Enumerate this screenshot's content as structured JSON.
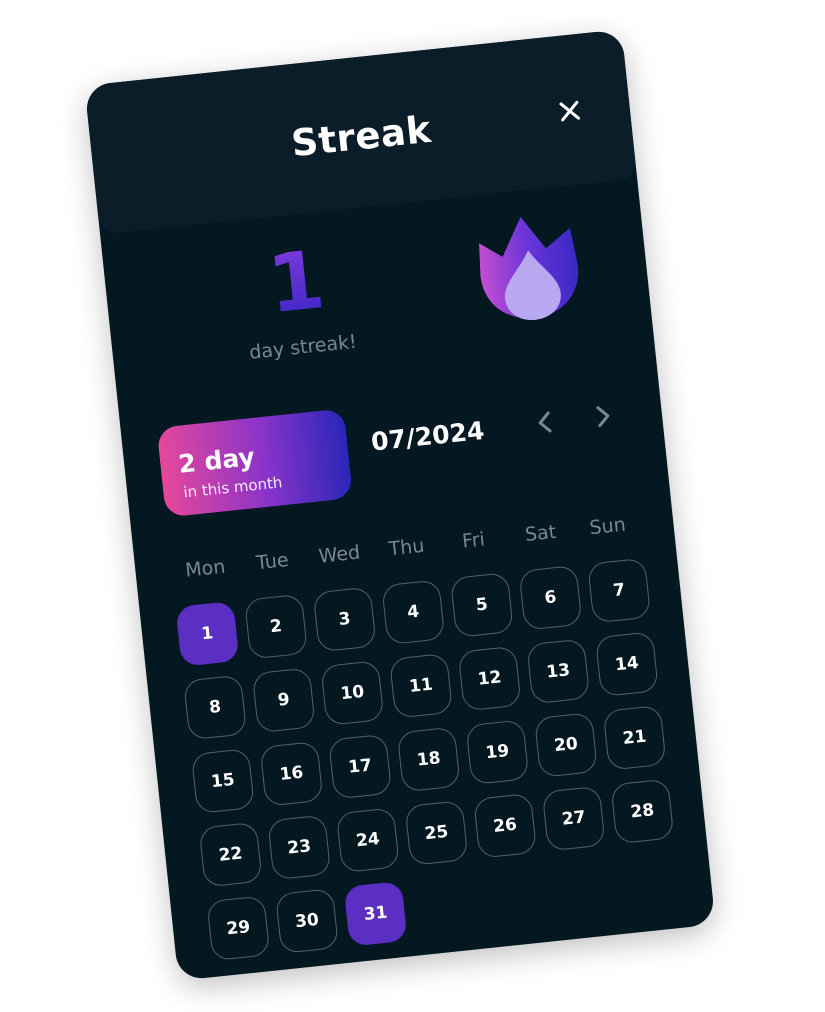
{
  "header": {
    "title": "Streak"
  },
  "streak": {
    "count": "1",
    "caption": "day streak!"
  },
  "month_summary": {
    "value": "2 day",
    "caption": "in this month"
  },
  "calendar": {
    "month_label": "07/2024",
    "weekdays": [
      "Mon",
      "Tue",
      "Wed",
      "Thu",
      "Fri",
      "Sat",
      "Sun"
    ],
    "days": [
      "1",
      "2",
      "3",
      "4",
      "5",
      "6",
      "7",
      "8",
      "9",
      "10",
      "11",
      "12",
      "13",
      "14",
      "15",
      "16",
      "17",
      "18",
      "19",
      "20",
      "21",
      "22",
      "23",
      "24",
      "25",
      "26",
      "27",
      "28",
      "29",
      "30",
      "31"
    ],
    "active_days": [
      "1",
      "31"
    ]
  },
  "colors": {
    "card_bg": "#041821",
    "accent": "#5a2fc2",
    "badge_gradient": [
      "#e6489a",
      "#2926b8"
    ]
  },
  "icons": {
    "close": "close-icon",
    "flame": "flame-icon",
    "prev": "chevron-left-icon",
    "next": "chevron-right-icon"
  }
}
